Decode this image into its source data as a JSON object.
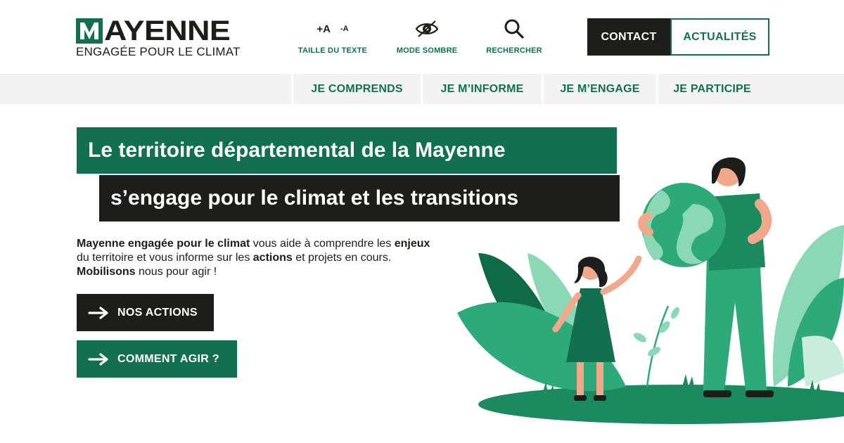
{
  "logo": {
    "wordmark_rest": "AYENNE",
    "tagline": "ENGAGÉE POUR LE CLIMAT"
  },
  "toolbar": {
    "text_size_increase": "+A",
    "text_size_decrease": "-A",
    "text_size_label": "TAILLE DU TEXTE",
    "dark_mode_label": "MODE SOMBRE",
    "search_label": "RECHERCHER"
  },
  "header_buttons": {
    "contact": "CONTACT",
    "news": "ACTUALITÉS"
  },
  "nav": {
    "items": [
      {
        "label": "JE COMPRENDS"
      },
      {
        "label": "JE M’INFORME"
      },
      {
        "label": "JE M’ENGAGE"
      },
      {
        "label": "JE PARTICIPE"
      }
    ]
  },
  "hero": {
    "title_line1": "Le territoire départemental de la Mayenne",
    "title_line2": "s’engage pour le climat et les transitions",
    "intro": {
      "part1_bold": "Mayenne engagée pour le climat",
      "part2": " vous aide à comprendre les ",
      "part3_bold": "enjeux",
      "part4": " du territoire et vous informe sur les ",
      "part5_bold": "actions",
      "part6": " et projets en cours. ",
      "part7_bold": "Mobilisons",
      "part8": " nous pour agir !"
    },
    "cta_primary": "NOS ACTIONS",
    "cta_secondary": "COMMENT AGIR ?"
  },
  "colors": {
    "brand_green": "#127050",
    "dark": "#1d1d1b",
    "light_green": "#2eaa7a",
    "pale_green": "#7fd3b0",
    "nav_bg": "#f3f3f3"
  },
  "icons": {
    "text_size": "text-size-icon",
    "dark_mode": "eye-icon",
    "search": "search-icon",
    "cta_arrow": "arrow-right-icon"
  }
}
